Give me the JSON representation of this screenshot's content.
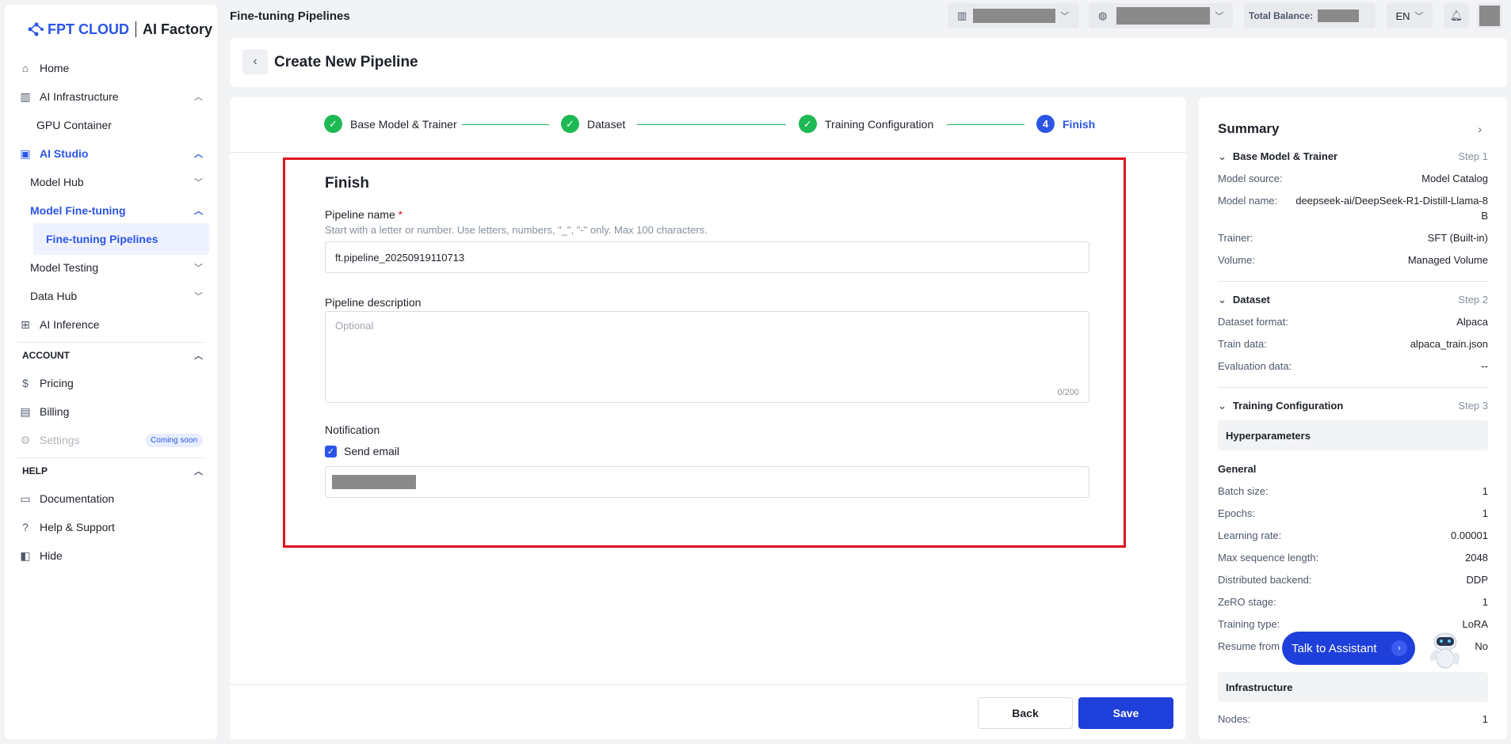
{
  "brand": {
    "logo": "FPT CLOUD",
    "product": "AI Factory"
  },
  "sidebar": {
    "items": [
      {
        "label": "Home",
        "icon": "home-icon"
      },
      {
        "label": "AI Infrastructure",
        "icon": "building-icon"
      },
      {
        "label": "GPU Container"
      },
      {
        "label": "AI Studio",
        "icon": "studio-icon"
      },
      {
        "label": "Model Hub"
      },
      {
        "label": "Model Fine-tuning"
      },
      {
        "label": "Fine-tuning Pipelines"
      },
      {
        "label": "Model Testing"
      },
      {
        "label": "Data Hub"
      },
      {
        "label": "AI Inference",
        "icon": "grid-icon"
      }
    ],
    "account_title": "ACCOUNT",
    "account": [
      {
        "label": "Pricing",
        "icon": "dollar-icon"
      },
      {
        "label": "Billing",
        "icon": "invoice-icon"
      },
      {
        "label": "Settings",
        "icon": "gear-icon",
        "badge": "Coming soon"
      }
    ],
    "help_title": "HELP",
    "help": [
      {
        "label": "Documentation",
        "icon": "book-icon"
      },
      {
        "label": "Help & Support",
        "icon": "question-icon"
      },
      {
        "label": "Hide",
        "icon": "panel-icon"
      }
    ]
  },
  "topbar": {
    "page_title": "Fine-tuning Pipelines",
    "balance_label": "Total Balance:",
    "language": "EN"
  },
  "header": {
    "title": "Create New Pipeline"
  },
  "steps": [
    {
      "num": "1",
      "label": "Base Model & Trainer",
      "state": "done"
    },
    {
      "num": "2",
      "label": "Dataset",
      "state": "done"
    },
    {
      "num": "3",
      "label": "Training Configuration",
      "state": "done"
    },
    {
      "num": "4",
      "label": "Finish",
      "state": "current"
    }
  ],
  "form": {
    "title": "Finish",
    "name_label": "Pipeline name",
    "required_mark": "*",
    "name_hint": "Start with a letter or number. Use letters, numbers, \"_\", \"-\" only. Max 100 characters.",
    "name_value": "ft.pipeline_20250919110713",
    "desc_label": "Pipeline description",
    "desc_placeholder": "Optional",
    "desc_counter": "0/200",
    "notification_label": "Notification",
    "send_email_label": "Send email",
    "send_email_checked": true
  },
  "actions": {
    "back": "Back",
    "save": "Save"
  },
  "summary": {
    "title": "Summary",
    "sections": {
      "s1": {
        "name": "Base Model & Trainer",
        "step": "Step 1"
      },
      "s2": {
        "name": "Dataset",
        "step": "Step 2"
      },
      "s3": {
        "name": "Training Configuration",
        "step": "Step 3"
      }
    },
    "base": [
      {
        "k": "Model source:",
        "v": "Model Catalog"
      },
      {
        "k": "Model name:",
        "v": "deepseek-ai/DeepSeek-R1-Distill-Llama-8B"
      },
      {
        "k": "Trainer:",
        "v": "SFT (Built-in)"
      },
      {
        "k": "Volume:",
        "v": "Managed Volume"
      }
    ],
    "dataset": [
      {
        "k": "Dataset format:",
        "v": "Alpaca"
      },
      {
        "k": "Train data:",
        "v": "alpaca_train.json"
      },
      {
        "k": "Evaluation data:",
        "v": "--"
      }
    ],
    "hyper_title": "Hyperparameters",
    "general_title": "General",
    "general": [
      {
        "k": "Batch size:",
        "v": "1"
      },
      {
        "k": "Epochs:",
        "v": "1"
      },
      {
        "k": "Learning rate:",
        "v": "0.00001"
      },
      {
        "k": "Max sequence length:",
        "v": "2048"
      },
      {
        "k": "Distributed backend:",
        "v": "DDP"
      },
      {
        "k": "ZeRO stage:",
        "v": "1"
      },
      {
        "k": "Training type:",
        "v": "LoRA"
      },
      {
        "k": "Resume from",
        "v": "No"
      }
    ],
    "infra_title": "Infrastructure",
    "infra": [
      {
        "k": "Nodes:",
        "v": "1"
      }
    ]
  },
  "assistant": {
    "label": "Talk to Assistant"
  },
  "colors": {
    "primary": "#1f3fdb",
    "success": "#1db954",
    "highlight": "#e0141f"
  }
}
